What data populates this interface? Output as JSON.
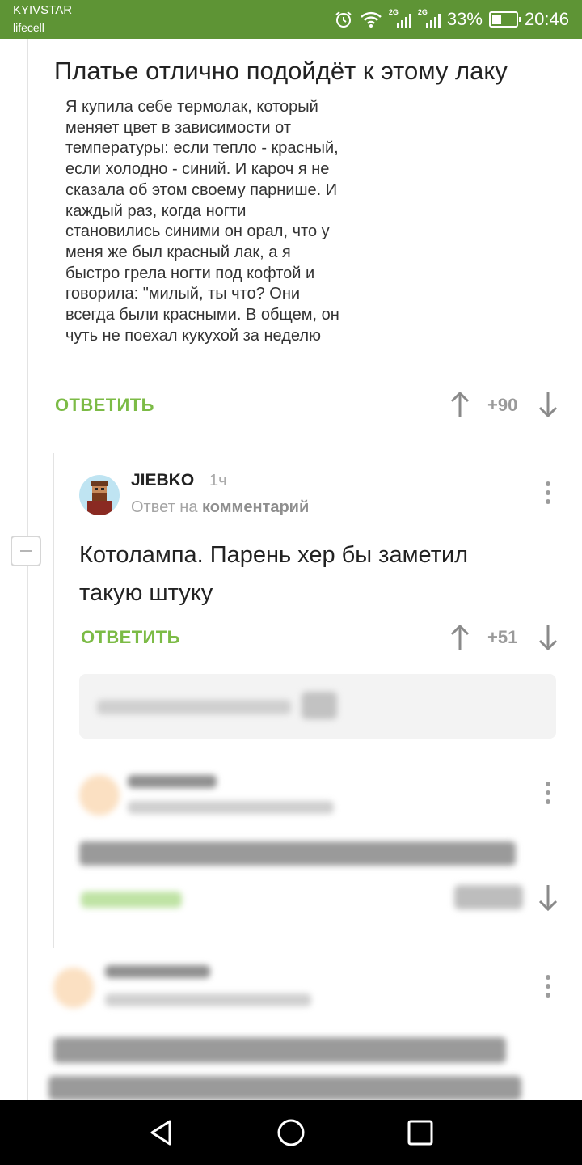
{
  "status_bar": {
    "carrier_1": "KYIVSTAR",
    "carrier_2": "lifecell",
    "network_1": "2G",
    "network_2": "2G",
    "battery": "33%",
    "time": "20:46",
    "icons": [
      "alarm-icon",
      "wifi-icon",
      "signal-icon",
      "signal-icon",
      "battery-icon"
    ]
  },
  "post": {
    "title": "Платье отлично подойдёт к этому лаку",
    "image_text": "Я купила себе термолак, который меняет цвет в зависимости от температуры: если тепло - красный, если холодно - синий. И кароч я не сказала об этом своему парнише. И каждый раз, когда ногти становились синими он орал, что у меня же был красный лак, а я быстро грела ногти под кофтой и говорила: \"милый, ты что? Они всегда были красными. В общем, он чуть не поехал кукухой за неделю",
    "reply_label": "ОТВЕТИТЬ",
    "score": "+90"
  },
  "comment": {
    "username": "JIEBKO",
    "time": "1ч",
    "reply_to_prefix": "Ответ на",
    "reply_to_link": "комментарий",
    "text_line_1": "Котолампа. Парень хер бы заметил",
    "text_line_2": "такую штуку",
    "reply_label": "ОТВЕТИТЬ",
    "score": "+51"
  },
  "colors": {
    "status_bar": "#5e9435",
    "accent_green": "#7cbb46",
    "score_grey": "#9a9a9a"
  }
}
